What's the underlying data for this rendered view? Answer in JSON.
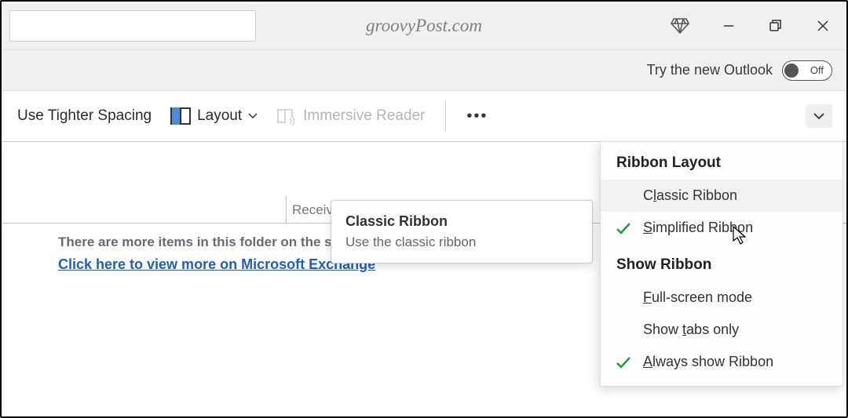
{
  "title": "groovyPost.com",
  "banner": {
    "try_label": "Try the new Outlook",
    "toggle_state": "Off"
  },
  "ribbon": {
    "tighter_spacing": "Use Tighter Spacing",
    "layout": "Layout",
    "immersive_reader": "Immersive Reader"
  },
  "grid": {
    "received_col": "Receive"
  },
  "folder": {
    "more_items": "There are more items in this folder on the server",
    "link_text": "Click here to view more on Microsoft Exchange"
  },
  "tooltip": {
    "title": "Classic Ribbon",
    "desc": "Use the classic ribbon"
  },
  "dropdown": {
    "section1": "Ribbon Layout",
    "items1": [
      {
        "label": "Classic Ribbon",
        "checked": false,
        "hover": true,
        "u": "l"
      },
      {
        "label": "Simplified Ribbon",
        "checked": true,
        "hover": false,
        "u": "S"
      }
    ],
    "section2": "Show Ribbon",
    "items2": [
      {
        "label": "Full-screen mode",
        "checked": false,
        "u": "F"
      },
      {
        "label": "Show tabs only",
        "checked": false,
        "u": "t"
      },
      {
        "label": "Always show Ribbon",
        "checked": true,
        "u": "A"
      }
    ]
  }
}
